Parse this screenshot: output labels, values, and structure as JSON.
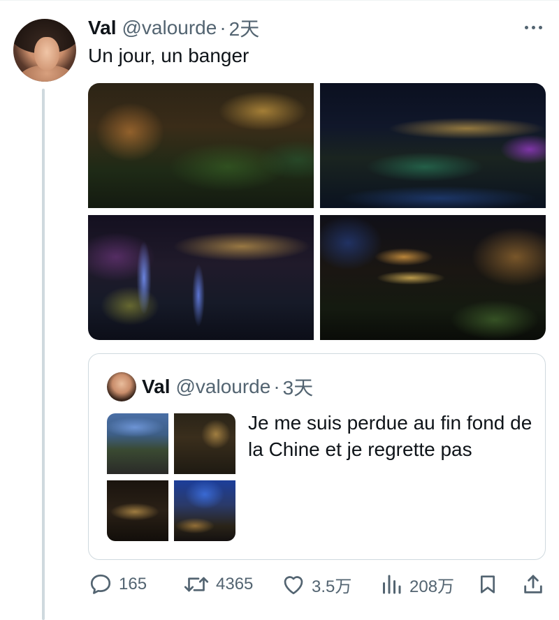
{
  "tweet": {
    "author_name": "Val",
    "author_handle": "@valourde",
    "separator": "·",
    "time": "2天",
    "text": "Un jour, un banger",
    "more_icon": "more-horizontal-icon",
    "photos": [
      {
        "name": "photo-1",
        "description": "night-village-street"
      },
      {
        "name": "photo-2",
        "description": "night-river-town"
      },
      {
        "name": "photo-3",
        "description": "night-waterfall"
      },
      {
        "name": "photo-4",
        "description": "night-covered-bridge"
      }
    ]
  },
  "quoted_tweet": {
    "author_name": "Val",
    "author_handle": "@valourde",
    "separator": "·",
    "time": "3天",
    "text": "Je me suis perdue au fin fond de la Chine et je regrette pas"
  },
  "actions": {
    "reply_count": "165",
    "retweet_count": "4365",
    "like_count": "3.5万",
    "views_count": "208万",
    "icons": [
      "reply-icon",
      "retweet-icon",
      "like-icon",
      "views-icon",
      "bookmark-icon",
      "share-icon"
    ]
  },
  "colors": {
    "text_primary": "#0f1419",
    "text_secondary": "#536471",
    "border": "#cfd9de"
  }
}
